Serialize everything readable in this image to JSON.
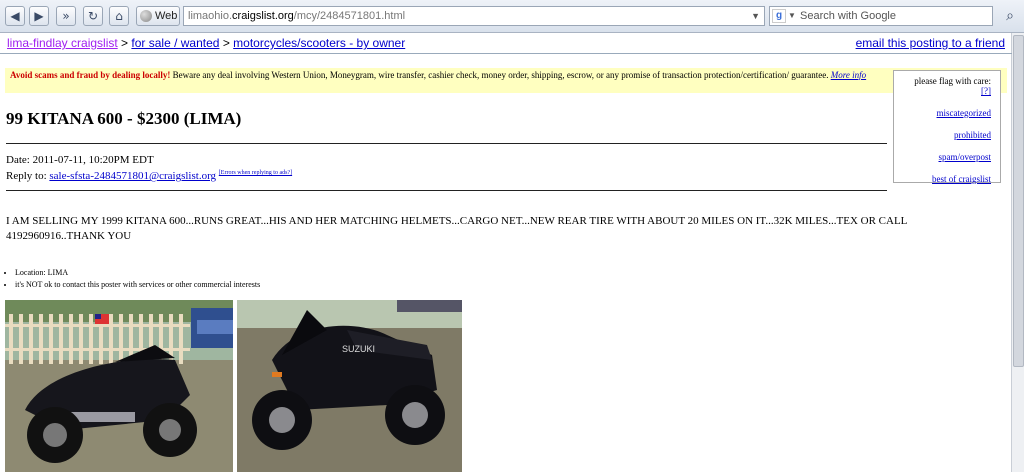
{
  "browser": {
    "web_label": "Web",
    "url_domain_prefix": "limaohio.",
    "url_domain": "craigslist.org",
    "url_path": "/mcy/2484571801.html",
    "search_placeholder": "Search with Google"
  },
  "header": {
    "breadcrumbs": [
      "lima-findlay craigslist",
      "for sale / wanted",
      "motorcycles/scooters - by owner"
    ],
    "separator": ">",
    "email_link": "email this posting to a friend"
  },
  "warning": {
    "bold": "Avoid scams and fraud by dealing locally!",
    "text": " Beware any deal involving Western Union, Moneygram, wire transfer, cashier check, money order, shipping, escrow, or any promise of transaction protection/certification/ guarantee.",
    "link": "More info"
  },
  "flag": {
    "header": "please flag with care:",
    "help": "[?]",
    "items": [
      "miscategorized",
      "prohibited",
      "spam/overpost",
      "best of craigslist"
    ]
  },
  "posting": {
    "title": "99 KITANA 600 - $2300 (LIMA)",
    "date": "Date: 2011-07-11, 10:20PM EDT",
    "reply_label": "Reply to: ",
    "reply_email": "sale-sfsta-2484571801@craigslist.org",
    "reply_errors": "[Errors when replying to ads?]",
    "body": "I AM SELLING MY 1999 KITANA 600...RUNS GREAT...HIS AND HER MATCHING HELMETS...CARGO NET...NEW REAR TIRE WITH ABOUT 20 MILES ON IT...32K MILES...TEX OR CALL 4192960916..THANK YOU",
    "attributes": [
      "Location: LIMA",
      "it's NOT ok to contact this poster with services or other commercial interests"
    ]
  },
  "photos": {
    "count": 2,
    "photo_2_brand": "SUZUKI"
  },
  "colors": {
    "link": "#0000cc",
    "visited": "#a020f0",
    "warning_bg": "#ffffc0",
    "warning_text": "#cc0000"
  }
}
